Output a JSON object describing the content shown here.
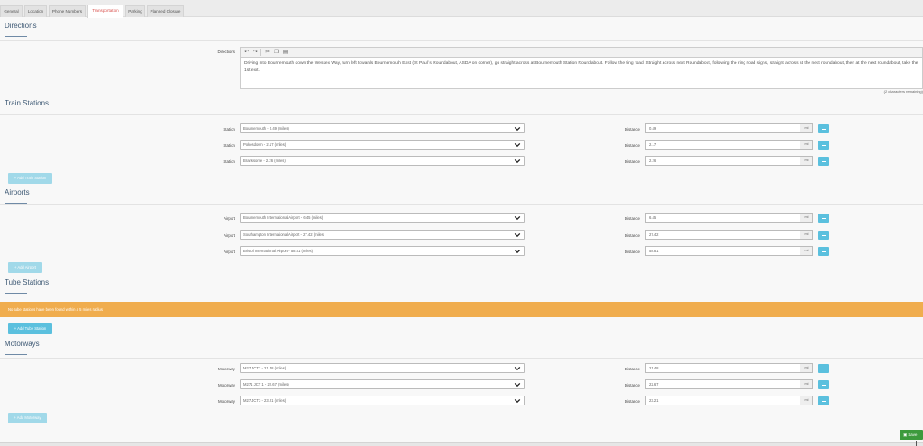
{
  "tabs": [
    "General",
    "Location",
    "Phone Numbers",
    "Transportation",
    "Parking",
    "Planned Closure"
  ],
  "directions": {
    "title": "Directions",
    "label": "Directions",
    "toolbar": [
      {
        "icon": "undo-icon",
        "glyph": "↶"
      },
      {
        "icon": "redo-icon",
        "glyph": "↷"
      },
      {
        "icon": "cut-icon",
        "glyph": "✂"
      },
      {
        "icon": "copy-icon",
        "glyph": "❐"
      },
      {
        "icon": "paste-icon",
        "glyph": "▤"
      }
    ],
    "text": "Driving into Bournemouth down the Wessex Way, turn left towards Bournemouth East (St Paul`s Roundabout, ASDA on corner), go straight across at Bournemouth Station Roundabout. Follow the ring road. Straight across next Roundabout, following the ring road signs, straight across at the next roundabout, then at the next roundabout, take the 1st exit.",
    "chars_remaining": "(2 characters remaining)"
  },
  "train": {
    "title": "Train Stations",
    "row_label": "Station",
    "distance_label": "Distance",
    "unit": "mi",
    "rows": [
      {
        "option": "Bournemouth - 0.49 (miles)",
        "distance": "0.49"
      },
      {
        "option": "Pokesdown - 2.17 (miles)",
        "distance": "2.17"
      },
      {
        "option": "Branksome - 2.26 (miles)",
        "distance": "2.26"
      }
    ],
    "add_label": "+ Add Train Station"
  },
  "airports": {
    "title": "Airports",
    "row_label": "Airport",
    "distance_label": "Distance",
    "unit": "mi",
    "rows": [
      {
        "option": "Bournemouth International Airport - 6.45 (miles)",
        "distance": "6.45"
      },
      {
        "option": "Southampton International Airport - 27.42 (miles)",
        "distance": "27.42"
      },
      {
        "option": "Bristol International Airport - 58.81 (miles)",
        "distance": "58.81"
      }
    ],
    "add_label": "+ Add Airport"
  },
  "tube": {
    "title": "Tube Stations",
    "alert": "No tube stations have been found within a 5 miles radius",
    "add_label": "+ Add Tube Station"
  },
  "motorways": {
    "title": "Motorways",
    "row_label": "Motorway",
    "distance_label": "Distance",
    "unit": "mi",
    "rows": [
      {
        "option": "M27 JCT2 - 21.48 (miles)",
        "distance": "21.48"
      },
      {
        "option": "M271 JCT 1 - 22.67 (miles)",
        "distance": "22.67"
      },
      {
        "option": "M27 JCT3 - 23.21 (miles)",
        "distance": "23.21"
      }
    ],
    "add_label": "+ Add Motorway"
  },
  "save_label": "Save",
  "colors": {
    "active_tab_text": "#d9534f",
    "info_button": "#5bc0de",
    "warning_alert": "#f0ad4e",
    "save_button": "#3c9a3c",
    "section_title": "#3f5a75"
  }
}
